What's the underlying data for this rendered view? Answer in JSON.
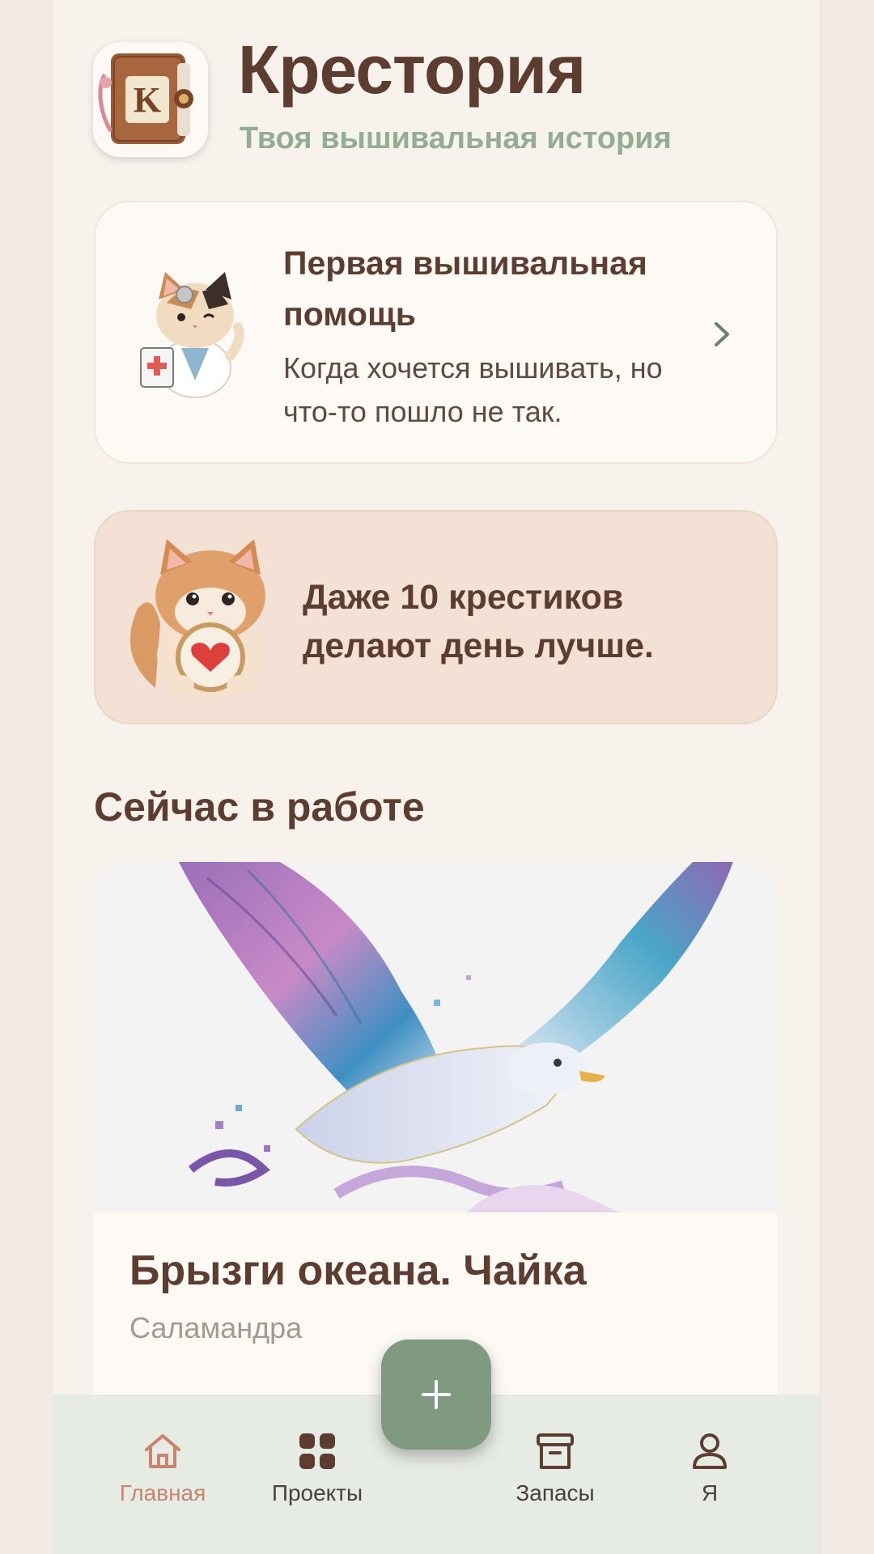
{
  "header": {
    "title": "Крестория",
    "subtitle": "Твоя вышивальная история",
    "logo_letter": "K"
  },
  "help_card": {
    "title": "Первая вышивальная помощь",
    "description": "Когда хочется вышивать, но что-то пошло не так."
  },
  "motivation_card": {
    "text": "Даже 10 крестиков делают день лучше."
  },
  "section": {
    "title": "Сейчас в работе"
  },
  "project": {
    "title": "Брызги океана. Чайка",
    "author": "Саламандра"
  },
  "nav": {
    "items": [
      {
        "label": "Главная",
        "icon": "home-icon",
        "active": true
      },
      {
        "label": "Проекты",
        "icon": "grid-icon",
        "active": false
      },
      {
        "label": "Запасы",
        "icon": "archive-icon",
        "active": false
      },
      {
        "label": "Я",
        "icon": "user-icon",
        "active": false
      }
    ],
    "fab_icon": "plus-icon"
  },
  "colors": {
    "brand_brown": "#5e3d31",
    "accent_green": "#7f9a80",
    "subtitle_green": "#93ad95",
    "active_nav": "#c98470"
  }
}
